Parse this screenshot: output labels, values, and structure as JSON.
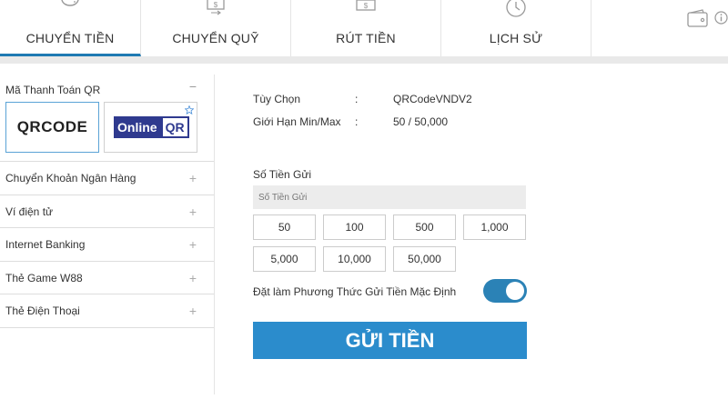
{
  "tabs": [
    {
      "label": "CHUYỂN TIỀN",
      "icon": "piggy-bank-icon",
      "active": true
    },
    {
      "label": "CHUYỂN QUỸ",
      "icon": "fund-transfer-icon"
    },
    {
      "label": "RÚT TIỀN",
      "icon": "withdraw-cash-icon"
    },
    {
      "label": "LỊCH SỬ",
      "icon": "history-clock-icon"
    },
    {
      "label": "",
      "icon": ""
    }
  ],
  "header_icons": {
    "wallet": "wallet-icon",
    "info": "info-icon"
  },
  "sidebar": {
    "section_title": "Mã Thanh Toán QR",
    "section_toggle": "−",
    "qr_options": [
      {
        "text": "QRCODE"
      },
      {
        "text_online": "Online",
        "text_qr": "QR"
      }
    ],
    "items": [
      {
        "label": "Chuyển Khoản Ngân Hàng",
        "toggle": "+"
      },
      {
        "label": "Ví điện tử",
        "toggle": "+"
      },
      {
        "label": "Internet Banking",
        "toggle": "+"
      },
      {
        "label": "Thẻ Game W88",
        "toggle": "+"
      },
      {
        "label": "Thẻ Điện Thoại",
        "toggle": "+"
      }
    ]
  },
  "main": {
    "info": [
      {
        "label": "Tùy Chọn",
        "colon": ":",
        "value": "QRCodeVNDV2"
      },
      {
        "label": "Giới Hạn Min/Max",
        "colon": ":",
        "value": "50 / 50,000"
      }
    ],
    "amount_label": "Số Tiền Gửi",
    "amount_placeholder": "Số Tiền Gửi",
    "amount_value": "",
    "quick_amounts": [
      "50",
      "100",
      "500",
      "1,000",
      "5,000",
      "10,000",
      "50,000"
    ],
    "default_method_label": "Đặt làm Phương Thức Gửi Tiền Mặc Định",
    "default_method_on": true,
    "submit_label": "GỬI TIỀN"
  },
  "colors": {
    "accent": "#2b8ccc",
    "toggle": "#2b82b6",
    "tab_underline": "#1f7ab3"
  }
}
